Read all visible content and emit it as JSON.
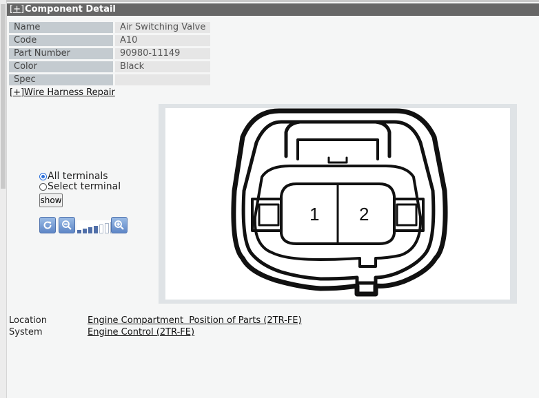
{
  "header": {
    "toggle": "[+]",
    "title": "Component Detail"
  },
  "details": [
    {
      "label": "Name",
      "value": "Air Switching Valve"
    },
    {
      "label": "Code",
      "value": "A10"
    },
    {
      "label": "Part Number",
      "value": "90980-11149"
    },
    {
      "label": "Color",
      "value": "Black"
    },
    {
      "label": "Spec",
      "value": ""
    }
  ],
  "wire_harness_link": "[+]Wire Harness Repair",
  "terminal_options": {
    "all_label": "All terminals",
    "select_label": "Select terminal",
    "selected": "all",
    "show_label": "show"
  },
  "zoom": {
    "level": 4,
    "max_level": 7,
    "reset_icon": "refresh-icon",
    "zoom_out_icon": "zoom-out-icon",
    "zoom_in_icon": "zoom-in-icon",
    "button_color": "#6b93cf"
  },
  "diagram": {
    "pins": [
      "1",
      "2"
    ]
  },
  "location": {
    "label": "Location",
    "value": "Engine Compartment  Position of Parts (2TR-FE)"
  },
  "system": {
    "label": "System",
    "value": "Engine Control (2TR-FE)"
  },
  "colors": {
    "header_bg": "#676767",
    "label_bg": "#c4cbd0",
    "value_bg": "#e6e6e6",
    "page_bg": "#f5f6f6"
  }
}
